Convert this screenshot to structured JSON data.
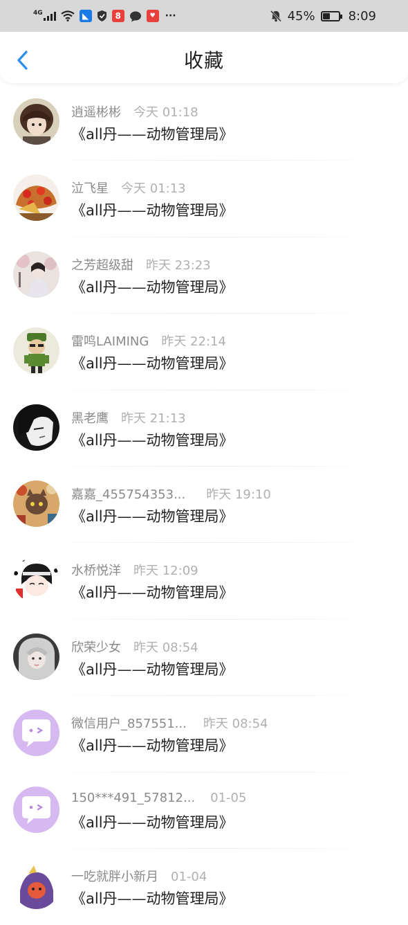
{
  "status_bar": {
    "network": "4G",
    "battery": "45%",
    "battery_level": 0.45,
    "time": "8:09",
    "more": "···",
    "icons": [
      "signal-icon",
      "wifi-icon",
      "blue-app-icon",
      "shield-icon",
      "red-app-icon",
      "chat-bubble-icon",
      "notification-app-icon",
      "mute-bell-icon",
      "battery-icon"
    ]
  },
  "header": {
    "title": "收藏",
    "back_icon": "chevron-left-icon",
    "accent_color": "#2f8ee8"
  },
  "items": [
    {
      "name": "逍遥彬彬",
      "time": "今天 01:18",
      "text": "《all丹——动物管理局》"
    },
    {
      "name": "泣飞星",
      "time": "今天 01:13",
      "text": "《all丹——动物管理局》"
    },
    {
      "name": "之芳超级甜",
      "time": "昨天 23:23",
      "text": "《all丹——动物管理局》"
    },
    {
      "name": "雷鸣LAIMING",
      "time": "昨天 22:14",
      "text": "《all丹——动物管理局》"
    },
    {
      "name": "黑老鹰",
      "time": "昨天 21:13",
      "text": "《all丹——动物管理局》"
    },
    {
      "name": "嘉嘉_455754353...",
      "time": "昨天 19:10",
      "text": "《all丹——动物管理局》"
    },
    {
      "name": "水桥悦洋",
      "time": "昨天 12:09",
      "text": "《all丹——动物管理局》"
    },
    {
      "name": "欣荣少女",
      "time": "昨天 08:54",
      "text": "《all丹——动物管理局》"
    },
    {
      "name": "微信用户_857551...",
      "time": "昨天 08:54",
      "text": "《all丹——动物管理局》"
    },
    {
      "name": "150***491_57812...",
      "time": "01-05",
      "text": "《all丹——动物管理局》"
    },
    {
      "name": "一吃就胖小新月",
      "time": "01-04",
      "text": "《all丹——动物管理局》"
    }
  ]
}
